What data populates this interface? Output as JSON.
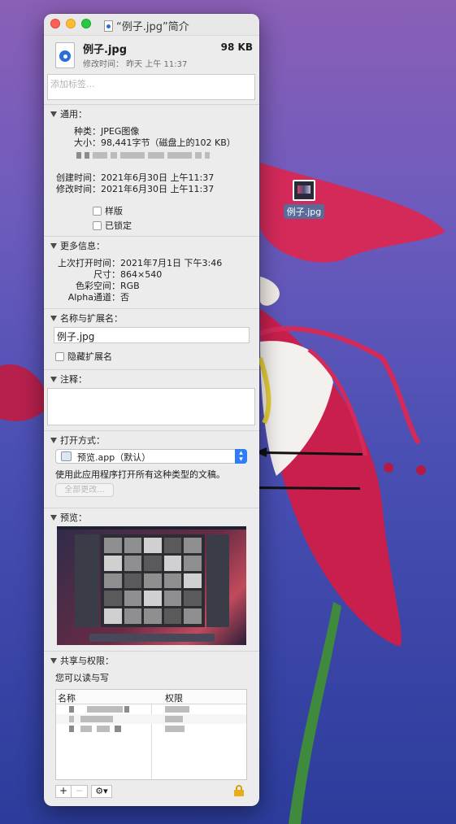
{
  "desktop": {
    "file_label": "例子.jpg"
  },
  "window": {
    "title": "“例子.jpg”简介",
    "file_name": "例子.jpg",
    "file_size": "98 KB",
    "modified_line": "修改时间： 昨天 上午 11:37",
    "tags_placeholder": "添加标签..."
  },
  "general": {
    "header": "通用：",
    "kind_label": "种类：",
    "kind_value": "JPEG图像",
    "size_label": "大小：",
    "size_value": "98,441字节（磁盘上的102 KB）",
    "created_label": "创建时间：",
    "created_value": "2021年6月30日 上午11:37",
    "modified_label": "修改时间：",
    "modified_value": "2021年6月30日 上午11:37",
    "stationery_label": "样版",
    "locked_label": "已锁定"
  },
  "more_info": {
    "header": "更多信息：",
    "last_opened_label": "上次打开时间：",
    "last_opened_value": "2021年7月1日 下午3:46",
    "dimensions_label": "尺寸：",
    "dimensions_value": "864×540",
    "color_space_label": "色彩空间：",
    "color_space_value": "RGB",
    "alpha_label": "Alpha通道：",
    "alpha_value": "否"
  },
  "name_ext": {
    "header": "名称与扩展名：",
    "value": "例子.jpg",
    "hide_ext_label": "隐藏扩展名"
  },
  "comments": {
    "header": "注释："
  },
  "open_with": {
    "header": "打开方式：",
    "app": "预览.app（默认）",
    "note": "使用此应用程序打开所有这种类型的文稿。",
    "change_all_label": "全部更改..."
  },
  "preview": {
    "header": "预览："
  },
  "sharing": {
    "header": "共享与权限：",
    "status": "您可以读与写",
    "col_name": "名称",
    "col_privilege": "权限"
  },
  "colors": {
    "accent": "#2f7cf6",
    "close": "#ff5f57",
    "minimize": "#febc2e",
    "maximize": "#28c840",
    "lock": "#e8ad1f"
  }
}
